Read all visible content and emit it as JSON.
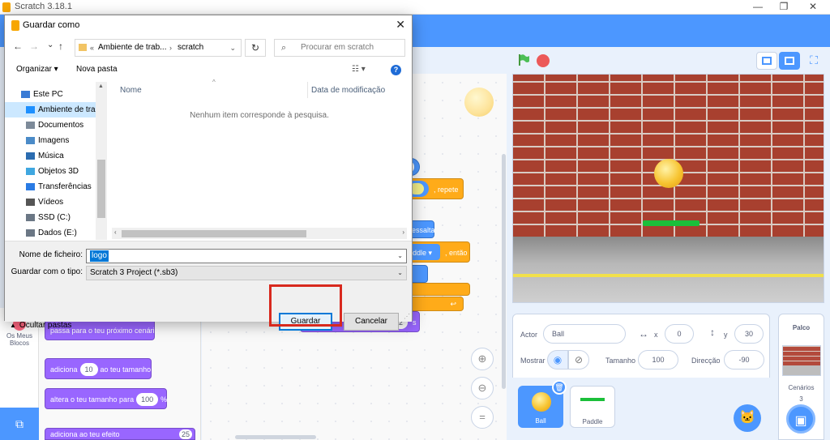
{
  "window": {
    "title": "Scratch 3.18.1",
    "controls": [
      "—",
      "❐",
      "✕"
    ]
  },
  "stage": {
    "sprite_info": {
      "actor_label": "Actor",
      "actor_name": "Ball",
      "x_label": "x",
      "x_value": "0",
      "y_label": "y",
      "y_value": "30",
      "show_label": "Mostrar",
      "size_label": "Tamanho",
      "size_value": "100",
      "direction_label": "Direcção",
      "direction_value": "-90"
    },
    "sprites": [
      {
        "name": "Ball",
        "selected": true
      },
      {
        "name": "Paddle",
        "selected": false
      }
    ],
    "stage_panel": {
      "title": "Palco",
      "backdrops_label": "Cenários",
      "backdrops_count": "3"
    }
  },
  "blocks": {
    "palette": [
      {
        "text": "passa para o teu próximo cenário"
      },
      {
        "pre": "adiciona",
        "num": "10",
        "post": "ao teu tamanho"
      },
      {
        "pre": "altera o teu tamanho para",
        "num": "100",
        "post": "%"
      }
    ],
    "palette_partial": "adiciona ao teu efeito",
    "palette_partial_num": "25",
    "category_label": "Os Meus Blocos",
    "script_fragments": {
      "num_top": "0",
      "repeat": ", repete",
      "bounce": "ressalta",
      "paddle": "ddle ▾",
      "then": ", então",
      "say_pre": "te",
      "say_mid": "durante",
      "say_num": "2",
      "say_post": "s"
    }
  },
  "dialog": {
    "title": "Guardar como",
    "nav": {
      "back": "←",
      "forward": "→",
      "dropdown": "⌄",
      "up": "↑",
      "path": [
        "Ambiente de trab...",
        "scratch"
      ],
      "path_prefix": "«",
      "search_placeholder": "Procurar em scratch"
    },
    "toolbar": {
      "organize": "Organizar ▾",
      "new_folder": "Nova pasta",
      "help": "?"
    },
    "tree": [
      {
        "label": "Este PC",
        "icon": "pc-icon",
        "color": "#3a7bd5"
      },
      {
        "label": "Ambiente de trab",
        "icon": "desktop-icon",
        "color": "#1e90ff",
        "selected": true
      },
      {
        "label": "Documentos",
        "icon": "documents-icon",
        "color": "#7d8a99"
      },
      {
        "label": "Imagens",
        "icon": "pictures-icon",
        "color": "#4b8bc8"
      },
      {
        "label": "Música",
        "icon": "music-icon",
        "color": "#2b6cb0"
      },
      {
        "label": "Objetos 3D",
        "icon": "objects3d-icon",
        "color": "#3fa7e0"
      },
      {
        "label": "Transferências",
        "icon": "downloads-icon",
        "color": "#2a7be4"
      },
      {
        "label": "Vídeos",
        "icon": "videos-icon",
        "color": "#555555"
      },
      {
        "label": "SSD (C:)",
        "icon": "drive-icon",
        "color": "#6b7785"
      },
      {
        "label": "Dados (E:)",
        "icon": "drive-icon",
        "color": "#6b7785"
      }
    ],
    "columns": {
      "name": "Nome",
      "modified": "Data de modificação"
    },
    "empty_message": "Nenhum item corresponde à pesquisa.",
    "filename_label": "Nome de ficheiro:",
    "filename_value": "logo",
    "filetype_label": "Guardar com o tipo:",
    "filetype_value": "Scratch 3 Project (*.sb3)",
    "hide_folders": "Ocultar pastas",
    "save_button": "Guardar",
    "cancel_button": "Cancelar"
  }
}
